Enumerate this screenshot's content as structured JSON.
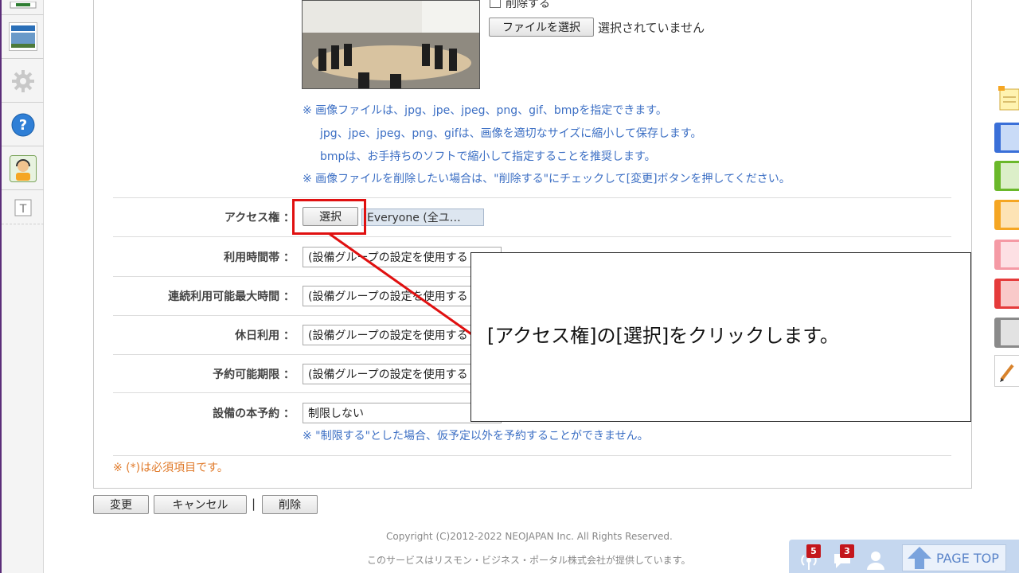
{
  "image_form": {
    "delete_checkbox_label": "削除する",
    "file_button": "ファイルを選択",
    "file_status": "選択されていません",
    "notes": [
      "※ 画像ファイルは、jpg、jpe、jpeg、png、gif、bmpを指定できます。",
      "jpg、jpe、jpeg、png、gifは、画像を適切なサイズに縮小して保存します。",
      "bmpは、お手持ちのソフトで縮小して指定することを推奨します。",
      "※ 画像ファイルを削除したい場合は、\"削除する\"にチェックして[変更]ボタンを押してください。"
    ]
  },
  "rows": {
    "access": {
      "label": "アクセス権 ：",
      "button": "選択",
      "value": "Everyone (全ユ…"
    },
    "usage_time": {
      "label": "利用時間帯 ：",
      "value": "(設備グループの設定を使用する"
    },
    "max_duration": {
      "label": "連続利用可能最大時間 ：",
      "value": "(設備グループの設定を使用する"
    },
    "holiday": {
      "label": "休日利用 ：",
      "value": "(設備グループの設定を使用する"
    },
    "reserve_limit": {
      "label": "予約可能期限 ：",
      "value": "(設備グループの設定を使用する"
    },
    "main_reservation": {
      "label": "設備の本予約 ：",
      "value": "制限しない",
      "note": "※ \"制限する\"とした場合、仮予定以外を予約することができません。"
    }
  },
  "required_note": "※ (*)は必須項目です。",
  "actions": {
    "change": "変更",
    "cancel": "キャンセル",
    "separator": "|",
    "delete": "削除"
  },
  "footer": {
    "copyright": "Copyright (C)2012-2022 NEOJAPAN Inc. All Rights Reserved.",
    "provider": "このサービスはリスモン・ビジネス・ポータル株式会社が提供しています。"
  },
  "callout": {
    "text": "[アクセス権]の[選択]をクリックします。"
  },
  "bottom_bar": {
    "badge_1": "5",
    "badge_2": "3",
    "page_top": "PAGE TOP"
  },
  "colors": {
    "note_blue": "#3c6fc4",
    "required_orange": "#e07a2a",
    "highlight_red": "#e01010",
    "right_tabs": [
      "#3a6fd8",
      "#6ab82a",
      "#f5a623",
      "#f59aa5",
      "#e53b3b",
      "#8a8a8a"
    ]
  }
}
